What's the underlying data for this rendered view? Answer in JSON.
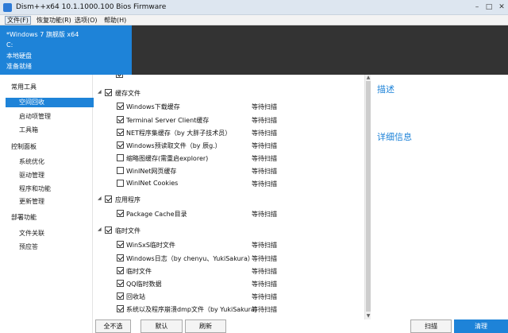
{
  "window": {
    "title": "Dism++x64 10.1.1000.100 Bios Firmware",
    "minimize": "–",
    "maximize": "□",
    "close": "✕"
  },
  "menu": [
    "文件(F)",
    "恢复功能(R)",
    "选项(O)",
    "帮助(H)"
  ],
  "image_info": {
    "lines": [
      "*Windows 7 旗舰版 x64",
      "C:",
      "本地硬盘",
      "准备就绪"
    ]
  },
  "sidebar": {
    "groups": [
      {
        "label": "常用工具",
        "items": [
          "空间回收",
          "启动项管理",
          "工具箱"
        ]
      },
      {
        "label": "控制面板",
        "items": [
          "系统优化",
          "驱动管理",
          "程序和功能",
          "更新管理"
        ]
      },
      {
        "label": "部署功能",
        "items": [
          "文件关联",
          "预应答"
        ]
      }
    ],
    "active_item": "空间回收"
  },
  "cleanup_tree": [
    {
      "kind": "group",
      "label": "缓存文件",
      "checked": true
    },
    {
      "kind": "item",
      "label": "Windows下载缓存",
      "status": "等待扫描",
      "checked": true
    },
    {
      "kind": "item",
      "label": "Terminal Server Client缓存",
      "status": "等待扫描",
      "checked": true
    },
    {
      "kind": "item",
      "label": "NET程序集缓存（by 大胖子技术员）",
      "status": "等待扫描",
      "checked": true
    },
    {
      "kind": "item",
      "label": "Windows预读取文件（by 辰g.）",
      "status": "等待扫描",
      "checked": true
    },
    {
      "kind": "item",
      "label": "缩略图缓存(需重启explorer)",
      "status": "等待扫描",
      "checked": false
    },
    {
      "kind": "item",
      "label": "WinINet网页缓存",
      "status": "等待扫描",
      "checked": false
    },
    {
      "kind": "item",
      "label": "WinINet Cookies",
      "status": "等待扫描",
      "checked": false
    },
    {
      "kind": "group",
      "label": "应用程序",
      "checked": true
    },
    {
      "kind": "item",
      "label": "Package Cache目录",
      "status": "等待扫描",
      "checked": true
    },
    {
      "kind": "group",
      "label": "临时文件",
      "checked": true
    },
    {
      "kind": "item",
      "label": "WinSxS临时文件",
      "status": "等待扫描",
      "checked": true
    },
    {
      "kind": "item",
      "label": "Windows日志（by chenyu、YukiSakura）",
      "status": "等待扫描",
      "checked": true
    },
    {
      "kind": "item",
      "label": "临时文件",
      "status": "等待扫描",
      "checked": true
    },
    {
      "kind": "item",
      "label": "QQ临时数据",
      "status": "等待扫描",
      "checked": true
    },
    {
      "kind": "item",
      "label": "回收站",
      "status": "等待扫描",
      "checked": true
    },
    {
      "kind": "item",
      "label": "系统以及程序崩溃dmp文件（by YukiSakura）",
      "status": "等待扫描",
      "checked": true
    }
  ],
  "detail": {
    "description_heading": "描述",
    "details_heading": "详细信息"
  },
  "buttons": {
    "select_none": "全不选",
    "default": "默认",
    "refresh": "刷新",
    "scan": "扫描",
    "clean": "清理"
  },
  "colors": {
    "accent": "#1e83d8",
    "header_dark": "#333333"
  }
}
